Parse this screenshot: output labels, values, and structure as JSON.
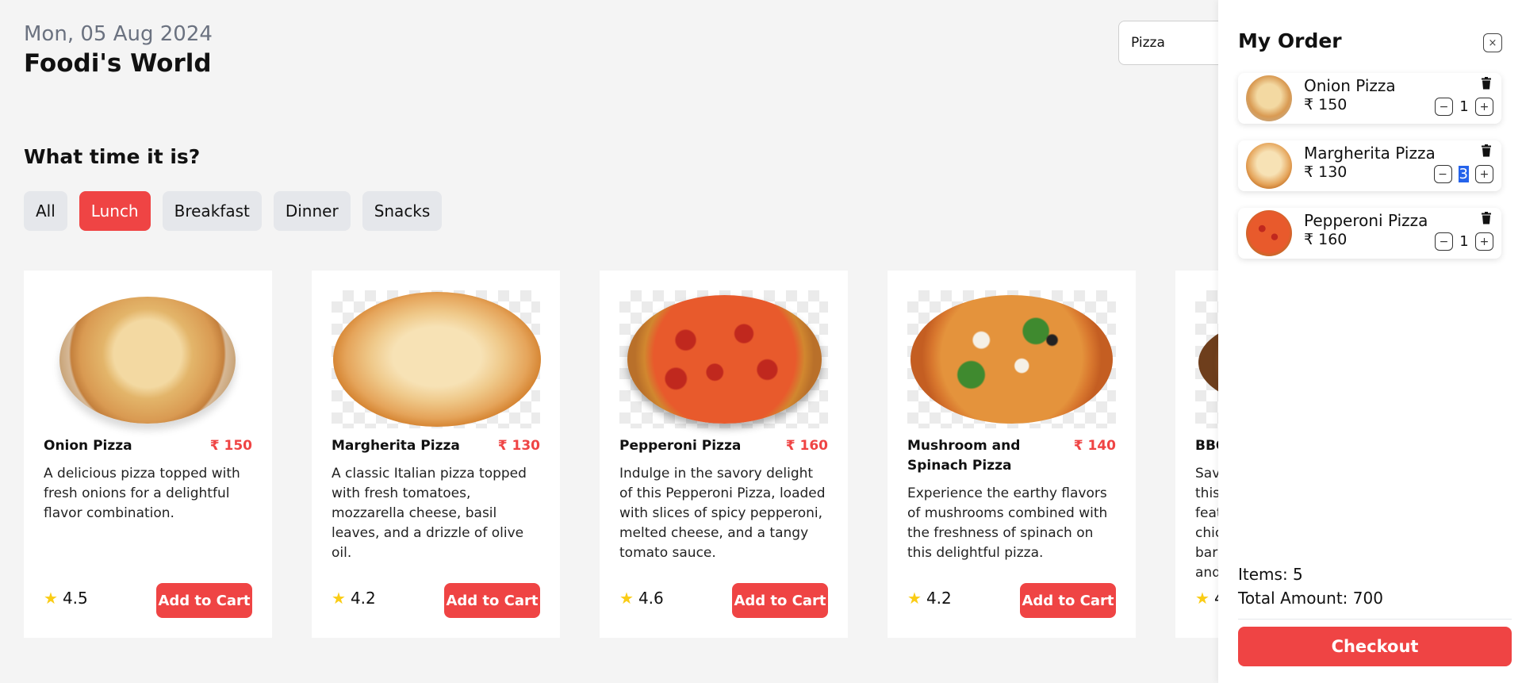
{
  "header": {
    "date": "Mon, 05 Aug 2024",
    "app_title": "Foodi's World",
    "search_value": "Pizza"
  },
  "categories": {
    "heading": "What time it is?",
    "items": [
      "All",
      "Lunch",
      "Breakfast",
      "Dinner",
      "Snacks"
    ],
    "active": "Lunch"
  },
  "menu": [
    {
      "name": "Onion Pizza",
      "price": "₹ 150",
      "description": "A delicious pizza topped with fresh onions for a delightful flavor combination.",
      "rating": "4.5",
      "button": "Add to Cart"
    },
    {
      "name": "Margherita Pizza",
      "price": "₹ 130",
      "description": "A classic Italian pizza topped with fresh tomatoes, mozzarella cheese, basil leaves, and a drizzle of olive oil.",
      "rating": "4.2",
      "button": "Add to Cart"
    },
    {
      "name": "Pepperoni Pizza",
      "price": "₹ 160",
      "description": "Indulge in the savory delight of this Pepperoni Pizza, loaded with slices of spicy pepperoni, melted cheese, and a tangy tomato sauce.",
      "rating": "4.6",
      "button": "Add to Cart"
    },
    {
      "name": "Mushroom and Spinach Pizza",
      "price": "₹ 140",
      "description": "Experience the earthy flavors of mushrooms combined with the freshness of spinach on this delightful pizza.",
      "rating": "4.2",
      "button": "Add to Cart"
    },
    {
      "name": "BBQ",
      "price": "",
      "description": "Sav this feat chic bar and",
      "rating": "4",
      "button": ""
    }
  ],
  "order": {
    "title": "My Order",
    "items": [
      {
        "name": "Onion Pizza",
        "price": "₹ 150",
        "qty": "1"
      },
      {
        "name": "Margherita Pizza",
        "price": "₹ 130",
        "qty": "3"
      },
      {
        "name": "Pepperoni Pizza",
        "price": "₹ 160",
        "qty": "1"
      }
    ],
    "items_text": "Items: 5",
    "total_text": "Total Amount: 700",
    "checkout_label": "Checkout"
  },
  "colors": {
    "accent": "#ef4444",
    "star": "#facc15",
    "background": "#f4f4f4",
    "chip": "#e5e7eb"
  },
  "icons": {
    "close": "close-icon",
    "delete": "trash-icon",
    "minus": "minus-icon",
    "plus": "plus-icon",
    "rating": "star-icon"
  },
  "symbols": {
    "star": "★",
    "close": "×",
    "minus": "−",
    "plus": "+"
  }
}
